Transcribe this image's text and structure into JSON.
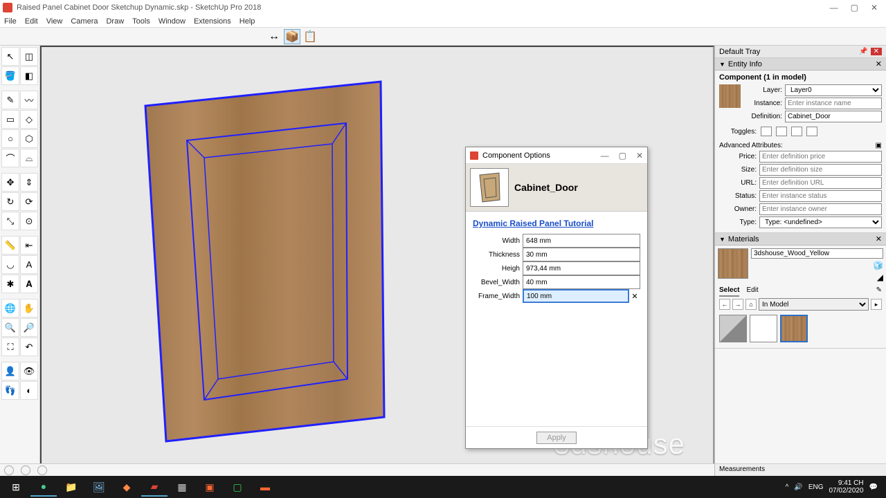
{
  "window": {
    "title": "Raised Panel Cabinet Door Sketchup Dynamic.skp - SketchUp Pro 2018"
  },
  "menu": [
    "File",
    "Edit",
    "View",
    "Camera",
    "Draw",
    "Tools",
    "Window",
    "Extensions",
    "Help"
  ],
  "dialog": {
    "title": "Component Options",
    "component_name": "Cabinet_Door",
    "link": "Dynamic Raised Panel Tutorial",
    "params": {
      "width_label": "Width",
      "width_value": "648 mm",
      "thickness_label": "Thickness",
      "thickness_value": "30 mm",
      "heigh_label": "Heigh",
      "heigh_value": "973,44 mm",
      "bevel_label": "Bevel_Width",
      "bevel_value": "40 mm",
      "frame_label": "Frame_Width",
      "frame_value": "100 mm"
    },
    "apply": "Apply"
  },
  "tray": {
    "title": "Default Tray",
    "entity_info": {
      "header": "Entity Info",
      "subtitle": "Component (1 in model)",
      "layer_label": "Layer:",
      "layer_value": "Layer0",
      "instance_label": "Instance:",
      "instance_placeholder": "Enter instance name",
      "definition_label": "Definition:",
      "definition_value": "Cabinet_Door",
      "toggles_label": "Toggles:",
      "adv_header": "Advanced Attributes:",
      "price_label": "Price:",
      "price_placeholder": "Enter definition price",
      "size_label": "Size:",
      "size_placeholder": "Enter definition size",
      "url_label": "URL:",
      "url_placeholder": "Enter definition URL",
      "status_label": "Status:",
      "status_placeholder": "Enter instance status",
      "owner_label": "Owner:",
      "owner_placeholder": "Enter instance owner",
      "type_label": "Type:",
      "type_value": "Type: <undefined>"
    },
    "materials": {
      "header": "Materials",
      "current": "3dshouse_Wood_Yellow",
      "tab_select": "Select",
      "tab_edit": "Edit",
      "scope": "In Model"
    },
    "measurements": "Measurements"
  },
  "watermark": "3dshouse",
  "taskbar": {
    "lang": "ENG",
    "time": "9:41 CH",
    "date": "07/02/2020"
  }
}
